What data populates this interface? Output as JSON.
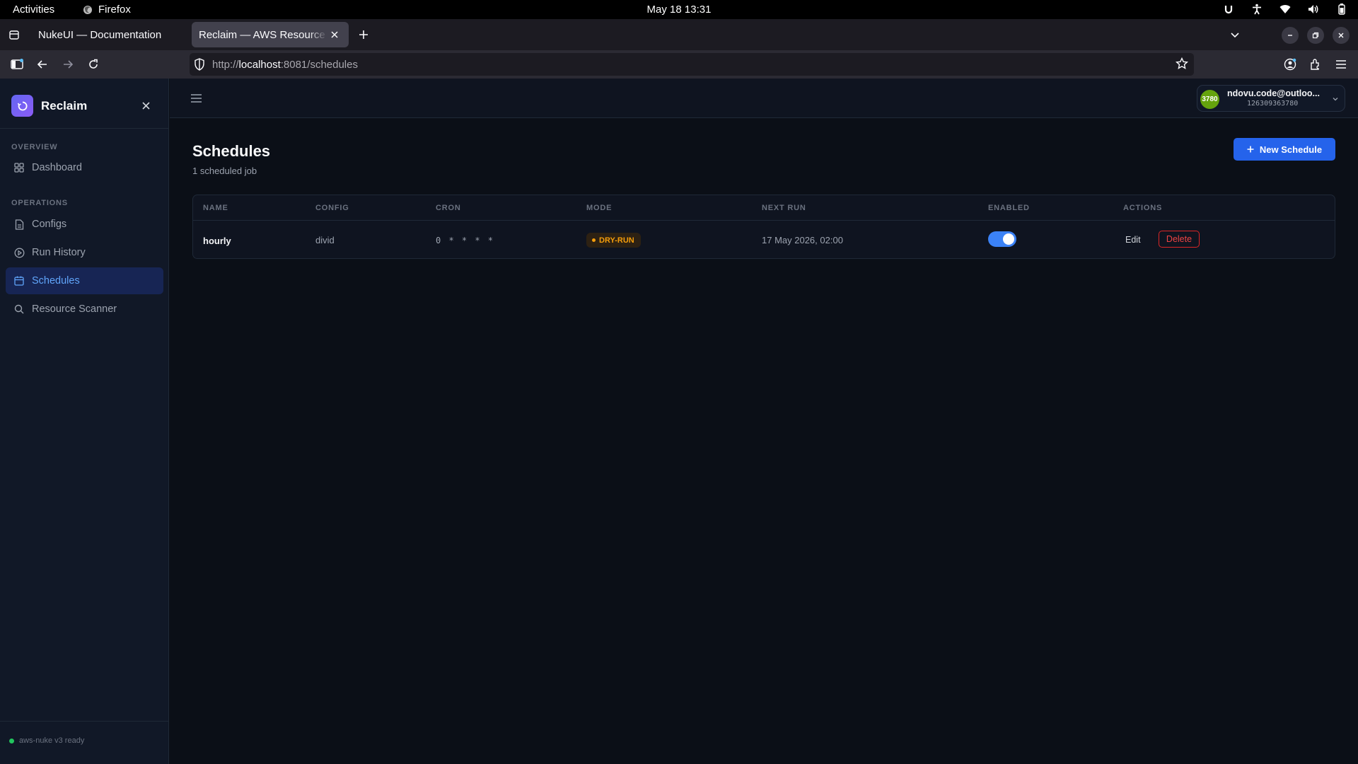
{
  "system_bar": {
    "activities": "Activities",
    "app_name": "Firefox",
    "clock": "May 18  13:31"
  },
  "browser": {
    "tabs": [
      {
        "title": "NukeUI — Documentation"
      },
      {
        "title": "Reclaim — AWS Resource Cl"
      }
    ],
    "url_host_prefix": "http://",
    "url_host": "localhost",
    "url_path": ":8081/schedules"
  },
  "sidebar": {
    "brand": "Reclaim",
    "sections": [
      {
        "label": "OVERVIEW"
      },
      {
        "label": "OPERATIONS"
      }
    ],
    "items": [
      {
        "label": "Dashboard",
        "icon": "grid-icon"
      },
      {
        "label": "Configs",
        "icon": "file-icon"
      },
      {
        "label": "Run History",
        "icon": "play-circle-icon"
      },
      {
        "label": "Schedules",
        "icon": "calendar-icon",
        "active": true
      },
      {
        "label": "Resource Scanner",
        "icon": "search-icon"
      }
    ],
    "status": "aws-nuke v3 ready"
  },
  "header": {
    "account": {
      "avatar_text": "3780",
      "email": "ndovu.code@outloo...",
      "account_id": "126309363780"
    }
  },
  "page": {
    "title": "Schedules",
    "subtitle": "1 scheduled job",
    "new_button": "New Schedule"
  },
  "table": {
    "columns": [
      "NAME",
      "CONFIG",
      "CRON",
      "MODE",
      "NEXT RUN",
      "ENABLED",
      "ACTIONS"
    ],
    "rows": [
      {
        "name": "hourly",
        "config": "divid",
        "cron": "0 * * * *",
        "mode": "DRY-RUN",
        "next_run": "17 May 2026, 02:00",
        "enabled": true,
        "edit": "Edit",
        "delete": "Delete"
      }
    ]
  },
  "colors": {
    "accent": "#2563eb",
    "active_nav": "#60a5fa",
    "dry_run": "#f59e0b",
    "danger": "#ef4444",
    "ready": "#22c55e"
  }
}
